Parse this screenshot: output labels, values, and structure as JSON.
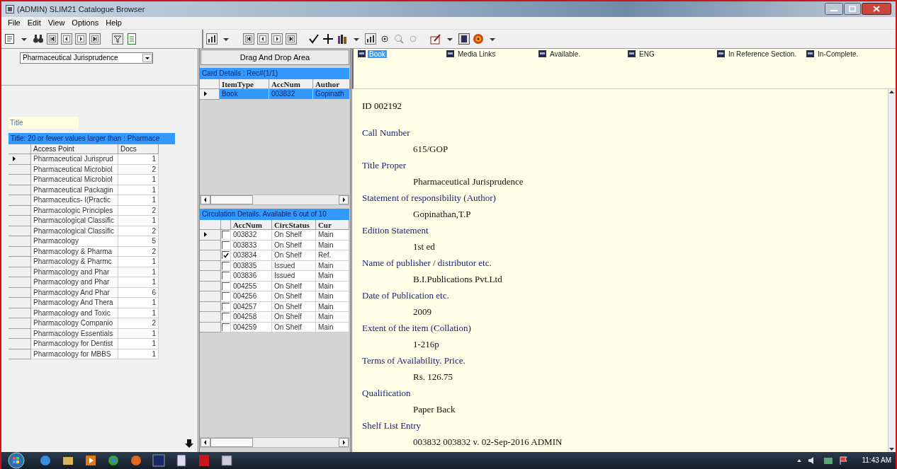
{
  "window": {
    "title": "(ADMIN) SLIM21 Catalogue Browser"
  },
  "menu": [
    "File",
    "Edit",
    "View",
    "Options",
    "Help"
  ],
  "left_pane": {
    "combo": {
      "value": "Pharmaceutical Jurisprudence"
    },
    "field_label": "Title",
    "grid": {
      "caption": "Title: 20 or fewer values larger than : Pharmace",
      "columns": [
        "Access Point",
        "Docs"
      ],
      "rows": [
        {
          "cells": [
            "Pharmaceutical Jurisprud",
            "1"
          ],
          "current": true
        },
        {
          "cells": [
            "Pharmaceutical Microbiol",
            "2"
          ],
          "current": false
        },
        {
          "cells": [
            "Pharmaceutical Microbiol",
            "1"
          ],
          "current": false
        },
        {
          "cells": [
            "Pharmaceutical Packagin",
            "1"
          ],
          "current": false
        },
        {
          "cells": [
            "Pharmaceutics- I(Practic",
            "1"
          ],
          "current": false
        },
        {
          "cells": [
            "Pharmacologic Principles",
            "2"
          ],
          "current": false
        },
        {
          "cells": [
            "Pharmacological Classific",
            "1"
          ],
          "current": false
        },
        {
          "cells": [
            "Pharmacological Classific",
            "2"
          ],
          "current": false
        },
        {
          "cells": [
            "Pharmacology",
            "5"
          ],
          "current": false
        },
        {
          "cells": [
            "Pharmacology & Pharma",
            "2"
          ],
          "current": false
        },
        {
          "cells": [
            "Pharmacology & Pharmc",
            "1"
          ],
          "current": false
        },
        {
          "cells": [
            "Pharmacology and Phar",
            "1"
          ],
          "current": false
        },
        {
          "cells": [
            "Pharmacology and Phar",
            "1"
          ],
          "current": false
        },
        {
          "cells": [
            "Pharmacology And Phar",
            "6"
          ],
          "current": false
        },
        {
          "cells": [
            "Pharmacology And Thera",
            "1"
          ],
          "current": false
        },
        {
          "cells": [
            "Pharmacology and Toxic",
            "1"
          ],
          "current": false
        },
        {
          "cells": [
            "Pharmacology Companio",
            "2"
          ],
          "current": false
        },
        {
          "cells": [
            "Pharmacology Essentials",
            "1"
          ],
          "current": false
        },
        {
          "cells": [
            "Pharmacology for Dentist",
            "1"
          ],
          "current": false
        },
        {
          "cells": [
            "Pharmacology for MBBS",
            "1"
          ],
          "current": false
        }
      ]
    }
  },
  "middle_pane": {
    "drop_button": "Drag And Drop Area",
    "card_grid": {
      "caption": "Card Details : Rec#(1/1)",
      "columns": [
        "ItemType",
        "AccNum",
        "Author"
      ],
      "rows": [
        {
          "cells": [
            "Book",
            "003832",
            "Gopinath"
          ],
          "current": true,
          "selected": true
        }
      ]
    },
    "circulation_grid": {
      "caption": "Circulation Details. Available 6 out of 10",
      "columns": [
        "AccNum",
        "CircStatus",
        "Cur"
      ],
      "rows": [
        {
          "cells": [
            "003832",
            "On Shelf",
            "Main"
          ],
          "checked": false,
          "current": true
        },
        {
          "cells": [
            "003833",
            "On Shelf",
            "Main"
          ],
          "checked": false,
          "current": false
        },
        {
          "cells": [
            "003834",
            "On Shelf",
            "Ref."
          ],
          "checked": true,
          "current": false
        },
        {
          "cells": [
            "003835",
            "Issued",
            "Main"
          ],
          "checked": false,
          "current": false
        },
        {
          "cells": [
            "003836",
            "Issued",
            "Main"
          ],
          "checked": false,
          "current": false
        },
        {
          "cells": [
            "004255",
            "On Shelf",
            "Main"
          ],
          "checked": false,
          "current": false
        },
        {
          "cells": [
            "004256",
            "On Shelf",
            "Main"
          ],
          "checked": false,
          "current": false
        },
        {
          "cells": [
            "004257",
            "On Shelf",
            "Main"
          ],
          "checked": false,
          "current": false
        },
        {
          "cells": [
            "004258",
            "On Shelf",
            "Main"
          ],
          "checked": false,
          "current": false
        },
        {
          "cells": [
            "004259",
            "On Shelf",
            "Main"
          ],
          "checked": false,
          "current": false
        }
      ]
    }
  },
  "record_pane": {
    "flags": [
      {
        "label": "Book",
        "selected": true
      },
      {
        "label": "Media Links",
        "selected": false
      },
      {
        "label": "Available.",
        "selected": false
      },
      {
        "label": "ENG",
        "selected": false
      },
      {
        "label": "In Reference Section.",
        "selected": false
      },
      {
        "label": "In-Complete.",
        "selected": false
      }
    ],
    "id": "ID 002192",
    "fields": [
      {
        "label": "Call Number",
        "value": "615/GOP"
      },
      {
        "label": "Title Proper",
        "value": "Pharmaceutical Jurisprudence"
      },
      {
        "label": "Statement of responsibility (Author)",
        "value": "Gopinathan,T.P"
      },
      {
        "label": "Edition Statement",
        "value": "1st ed"
      },
      {
        "label": "Name of publisher / distributor etc.",
        "value": "B.I.Publications Pvt.Ltd"
      },
      {
        "label": "Date of Publication etc.",
        "value": "2009"
      },
      {
        "label": "Extent of the item (Collation)",
        "value": "1-216p"
      },
      {
        "label": "Terms of Availability. Price.",
        "value": "Rs. 126.75"
      },
      {
        "label": "Qualification",
        "value": "Paper Back"
      },
      {
        "label": "Shelf List Entry",
        "value": "003832 003832 v. 02-Sep-2016 ADMIN"
      }
    ]
  },
  "taskbar": {
    "clock": "11:43 AM"
  }
}
